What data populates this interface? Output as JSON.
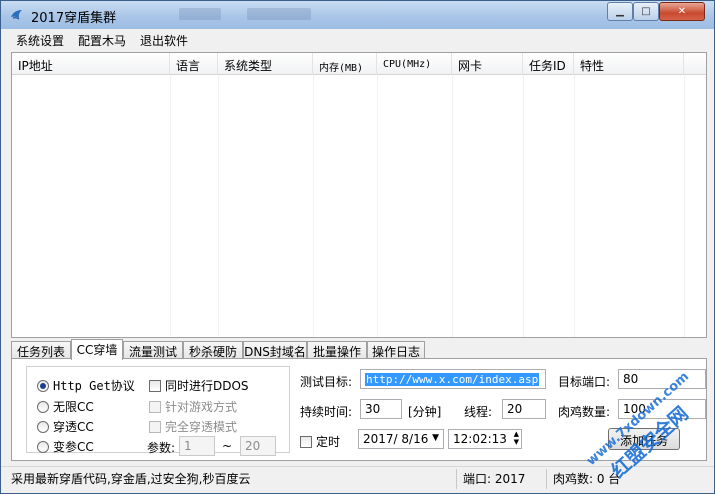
{
  "window": {
    "title": "2017穿盾集群",
    "controls": {
      "minimize": "▁",
      "maximize": "□",
      "close": "✕"
    }
  },
  "menu": [
    "系统设置",
    "配置木马",
    "退出软件"
  ],
  "list": {
    "columns": [
      "IP地址",
      "语言",
      "系统类型",
      "内存(MB)",
      "CPU(MHz)",
      "网卡",
      "任务ID",
      "特性"
    ],
    "rows": []
  },
  "tabs": [
    "任务列表",
    "CC穿墙",
    "流量测试",
    "秒杀硬防",
    "DNS封域名",
    "批量操作",
    "操作日志"
  ],
  "active_tab": "CC穿墙",
  "cc_panel": {
    "modes": [
      {
        "label": "Http Get协议",
        "selected": true
      },
      {
        "label": "无限CC",
        "selected": false
      },
      {
        "label": "穿透CC",
        "selected": false
      },
      {
        "label": "变参CC",
        "selected": false
      }
    ],
    "options": [
      {
        "label": "同时进行DDOS",
        "enabled": true
      },
      {
        "label": "针对游戏方式",
        "enabled": false
      },
      {
        "label": "完全穿透模式",
        "enabled": false
      }
    ],
    "params_label": "参数:",
    "param_from": "1",
    "param_sep": "~",
    "param_to": "20",
    "target_label": "测试目标:",
    "target_value": "http://www.x.com/index.asp",
    "port_label": "目标端口:",
    "port_value": "80",
    "duration_label": "持续时间:",
    "duration_value": "30",
    "duration_unit": "[分钟]",
    "threads_label": "线程:",
    "threads_value": "20",
    "bots_label": "肉鸡数量:",
    "bots_value": "100",
    "timed_label": "定时",
    "date_value": "2017/ 8/16",
    "time_value": "12:02:13",
    "add_task_label": "添加任务"
  },
  "status": {
    "message": "采用最新穿盾代码,穿金盾,过安全狗,秒百度云",
    "port": "端口: 2017",
    "bots": "肉鸡数: 0 台"
  },
  "watermark": {
    "line1": "红盟安全网",
    "line2": "www.7xdown.com"
  },
  "colors": {
    "titlebar": "#a9c6e8",
    "selection": "#3399ff",
    "watermark": "#1a6fd8"
  }
}
